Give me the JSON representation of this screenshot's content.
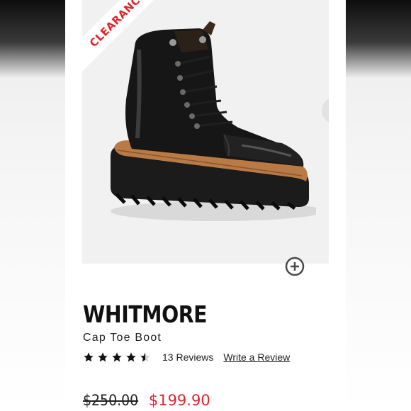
{
  "badge": {
    "label": "CLEARANCE"
  },
  "product": {
    "name": "WHITMORE",
    "subtitle": "Cap Toe Boot",
    "rating": 4.5,
    "reviews_label": "13 Reviews",
    "write_review_label": "Write a Review",
    "original_price": "$250.00",
    "sale_price": "$199.90"
  },
  "icons": {
    "next": "chevron-right-icon",
    "zoom": "plus-circle-icon",
    "star": "star-icon"
  },
  "colors": {
    "badge_text": "#e0262b",
    "sale_price": "#d8262c",
    "image_bg": "#f1f1f1"
  }
}
